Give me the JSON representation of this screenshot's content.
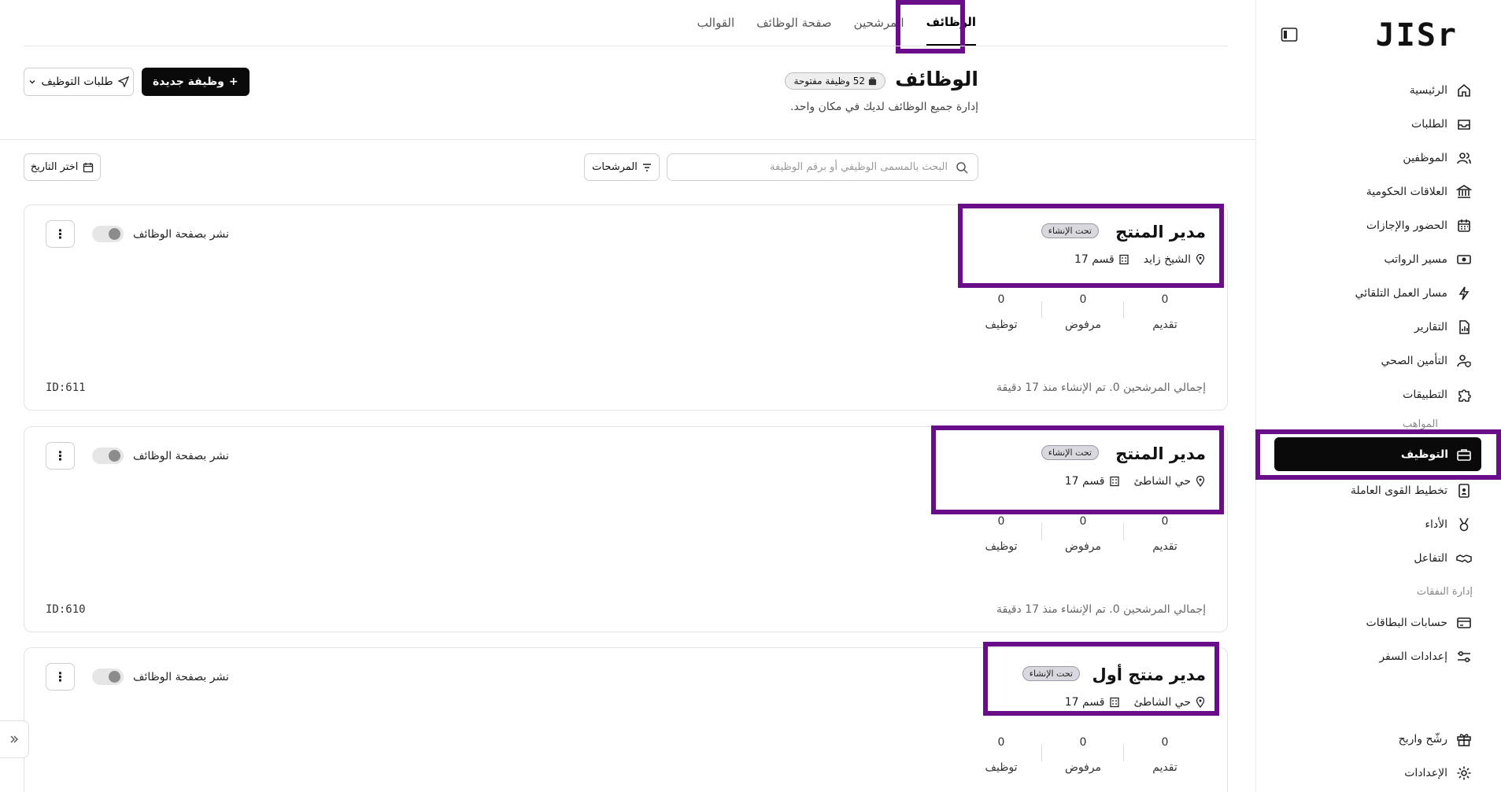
{
  "brand": {
    "logo_text": "JISr"
  },
  "sidebar": {
    "items": [
      {
        "label": "الرئيسية",
        "icon": "home-icon"
      },
      {
        "label": "الطلبات",
        "icon": "inbox-icon"
      },
      {
        "label": "الموظفين",
        "icon": "users-icon"
      },
      {
        "label": "العلاقات الحكومية",
        "icon": "government-building-icon"
      },
      {
        "label": "الحضور والإجازات",
        "icon": "calendar-icon"
      },
      {
        "label": "مسير الرواتب",
        "icon": "payroll-icon"
      },
      {
        "label": "مسار العمل التلقائي",
        "icon": "automation-icon"
      },
      {
        "label": "التقارير",
        "icon": "report-icon"
      },
      {
        "label": "التأمين الصحي",
        "icon": "health-insurance-icon"
      },
      {
        "label": "التطبيقات",
        "icon": "puzzle-icon"
      }
    ],
    "section_talent": "المواهب",
    "active_item": {
      "label": "التوظيف",
      "icon": "briefcase-icon"
    },
    "talent_items": [
      {
        "label": "تخطيط القوى العاملة",
        "icon": "id-badge-icon"
      },
      {
        "label": "الأداء",
        "icon": "medal-icon"
      },
      {
        "label": "التفاعل",
        "icon": "handshake-icon"
      }
    ],
    "section_expenses": "إدارة النفقات",
    "expense_items": [
      {
        "label": "حسابات البطاقات",
        "icon": "credit-card-icon"
      },
      {
        "label": "إعدادات السفر",
        "icon": "travel-settings-icon"
      }
    ],
    "bottom_items": [
      {
        "label": "رشّح واربح",
        "icon": "gift-icon"
      },
      {
        "label": "الإعدادات",
        "icon": "gear-icon"
      }
    ]
  },
  "tabs": [
    {
      "label": "الوظائف",
      "active": true
    },
    {
      "label": "المرشحين",
      "active": false
    },
    {
      "label": "صفحة الوظائف",
      "active": false
    },
    {
      "label": "القوالب",
      "active": false
    }
  ],
  "header": {
    "title": "الوظائف",
    "open_jobs_badge": "52 وظيفة مفتوحة",
    "subtitle": "إدارة جميع الوظائف لديك في مكان واحد.",
    "new_job_label": "وظيفة جديدة",
    "requests_label": "طلبات التوظيف"
  },
  "toolbar": {
    "search_placeholder": "البحث بالمسمى الوظيفي أو برقم الوظيفة",
    "filters_label": "المرشحات",
    "date_label": "اختر التاريخ"
  },
  "jobs": [
    {
      "title": "مدير المنتج",
      "status": "تحت الإنشاء",
      "location": "الشيخ زايد",
      "department": "قسم 17",
      "stats": {
        "applied": "0",
        "rejected": "0",
        "hired": "0"
      },
      "footer": "إجمالي المرشحين 0. تم الإنشاء منذ 17 دقيقة",
      "id": "ID:611",
      "publish_label": "نشر بصفحة الوظائف"
    },
    {
      "title": "مدير المنتج",
      "status": "تحت الإنشاء",
      "location": "حي الشاطئ",
      "department": "قسم 17",
      "stats": {
        "applied": "0",
        "rejected": "0",
        "hired": "0"
      },
      "footer": "إجمالي المرشحين 0. تم الإنشاء منذ 17 دقيقة",
      "id": "ID:610",
      "publish_label": "نشر بصفحة الوظائف"
    },
    {
      "title": "مدير منتج أول",
      "status": "تحت الإنشاء",
      "location": "حي الشاطئ",
      "department": "قسم 17",
      "stats": {
        "applied": "0",
        "rejected": "0",
        "hired": "0"
      },
      "publish_label": "نشر بصفحة الوظائف"
    }
  ],
  "stat_labels": {
    "applied": "تقديم",
    "rejected": "مرفوض",
    "hired": "توظيف"
  },
  "colors": {
    "highlight": "#6a0d8a",
    "primary": "#0a0a0a",
    "badge_bg": "#d8d8de"
  }
}
